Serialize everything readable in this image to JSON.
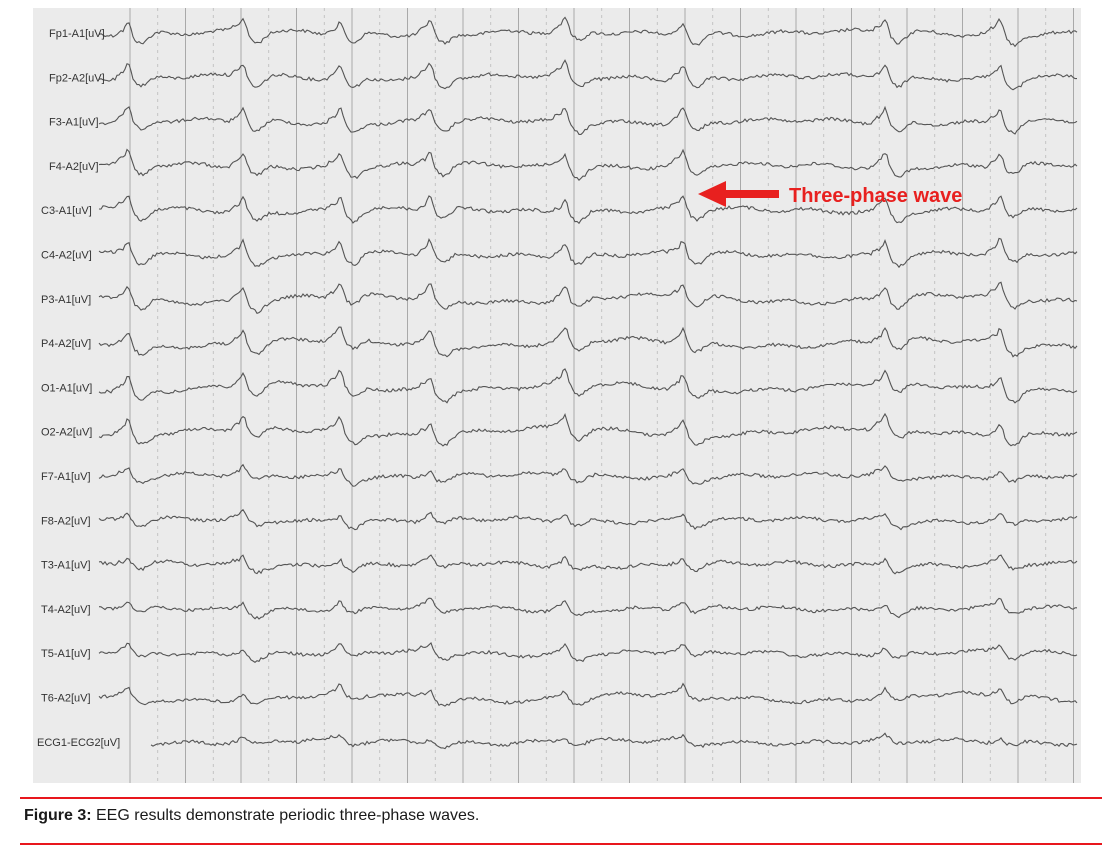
{
  "figure": {
    "channels": [
      "Fp1-A1[uV]",
      "Fp2-A2[uV]",
      "F3-A1[uV]",
      "F4-A2[uV]",
      "C3-A1[uV]",
      "C4-A2[uV]",
      "P3-A1[uV]",
      "P4-A2[uV]",
      "O1-A1[uV]",
      "O2-A2[uV]",
      "F7-A1[uV]",
      "F8-A2[uV]",
      "T3-A1[uV]",
      "T4-A2[uV]",
      "T5-A1[uV]",
      "T6-A2[uV]",
      "ECG1-ECG2[uV]"
    ],
    "annotation": {
      "text": "Three-phase wave",
      "color": "#e8201f"
    },
    "trace_color": "#555555",
    "paper_color": "#ebebeb"
  },
  "caption": {
    "label": "Figure 3:",
    "text": " EEG results demonstrate periodic three-phase waves."
  },
  "accent_color": "#e8171d"
}
